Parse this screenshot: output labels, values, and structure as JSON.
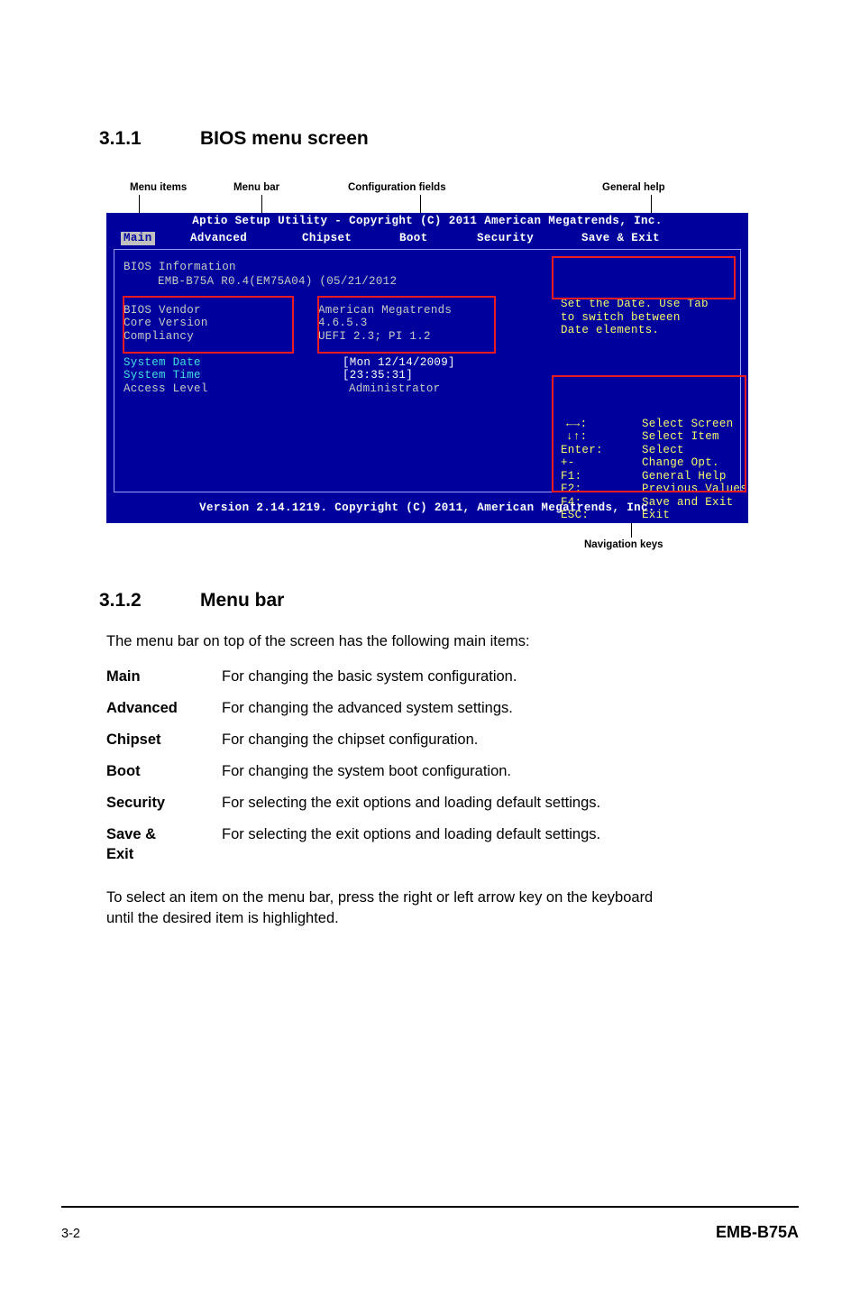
{
  "sections": {
    "s1": {
      "num": "3.1.1",
      "title": "BIOS menu screen"
    },
    "s2": {
      "num": "3.1.2",
      "title": "Menu bar"
    }
  },
  "callouts": {
    "menu_items": "Menu items",
    "menu_bar": "Menu bar",
    "configuration_fields": "Configuration fields",
    "general_help": "General help",
    "navigation_keys": "Navigation keys"
  },
  "bios": {
    "title": "Aptio Setup Utility - Copyright (C) 2011 American Megatrends, Inc.",
    "menu": [
      {
        "label": "Main",
        "active": true
      },
      {
        "label": "Advanced",
        "active": false
      },
      {
        "label": "Chipset",
        "active": false
      },
      {
        "label": "Boot",
        "active": false
      },
      {
        "label": "Security",
        "active": false
      },
      {
        "label": "Save & Exit",
        "active": false
      }
    ],
    "left": {
      "info_header": "BIOS Information",
      "info_line": "EMB-B75A R0.4(EM75A04) (05/21/2012",
      "items": [
        "BIOS Vendor",
        "Core Version",
        "Compliancy",
        "System Date",
        "System Time",
        "Access Level"
      ],
      "values": [
        "American Megatrends",
        "4.6.5.3",
        "UEFI 2.3; PI 1.2",
        "[Mon 12/14/2009]",
        "[23:35:31]",
        "Administrator"
      ]
    },
    "help_text": "Set the Date. Use Tab\nto switch between\nDate elements.",
    "nav_keys": [
      {
        "key": "←→:",
        "desc": "Select Screen"
      },
      {
        "key": "↓↑:",
        "desc": "Select Item"
      },
      {
        "key": "Enter:",
        "desc": "Select"
      },
      {
        "key": "+-",
        "desc": "Change Opt."
      },
      {
        "key": "F1:",
        "desc": "General Help"
      },
      {
        "key": "F2:",
        "desc": "Previous Values"
      },
      {
        "key": "F4:",
        "desc": "Save and Exit"
      },
      {
        "key": "ESC:",
        "desc": "Exit"
      }
    ],
    "footer": "Version 2.14.1219. Copyright (C) 2011, American Megatrends, Inc."
  },
  "menubar_section": {
    "intro": "The menu bar on top of the screen has the following main items:",
    "items": [
      {
        "term": "Main",
        "desc": "For changing the basic system configuration."
      },
      {
        "term": "Advanced",
        "desc": "For changing the advanced system settings."
      },
      {
        "term": "Chipset",
        "desc": "For changing the chipset configuration."
      },
      {
        "term": "Boot",
        "desc": "For changing the system boot configuration."
      },
      {
        "term": "Security",
        "desc": "For selecting the exit options and loading default settings."
      },
      {
        "term": "Save & Exit",
        "desc": "For selecting the exit options and loading default settings."
      }
    ],
    "outro_line1": "To select an item on the menu bar, press the right or left arrow key on the keyboard",
    "outro_line2": "until the desired item is highlighted."
  },
  "footer": {
    "page": "3-2",
    "model": "EMB-B75A"
  }
}
